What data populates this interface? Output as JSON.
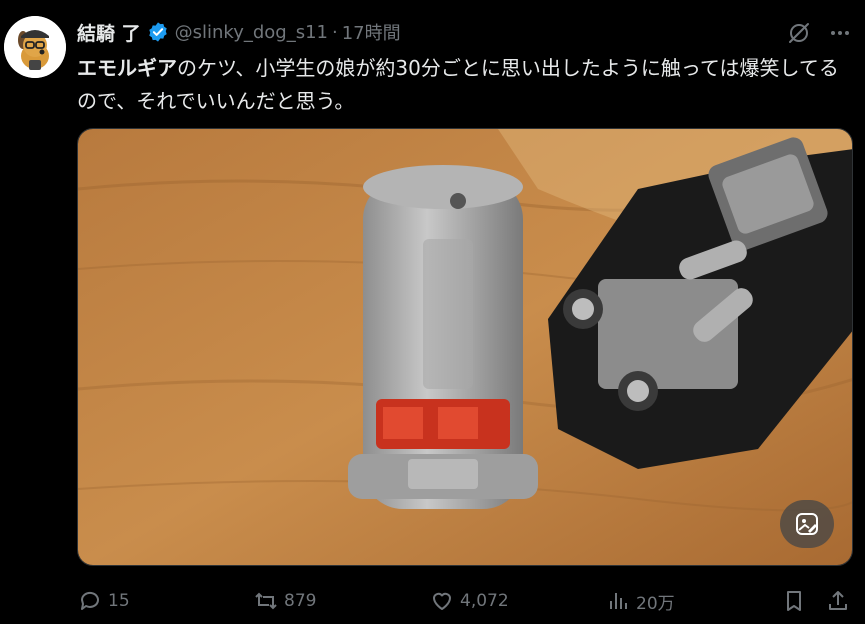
{
  "user": {
    "display_name": "結騎 了",
    "handle": "@slinky_dog_s11",
    "separator": "·",
    "time": "17時間",
    "verified_color": "#1d9bf0"
  },
  "tweet": {
    "text_bold": "エモルギア",
    "text_rest": "のケツ、小学生の娘が約30分ごとに思い出したように触っては爆笑してるので、それでいいんだと思う。"
  },
  "actions": {
    "replies": "15",
    "retweets": "879",
    "likes": "4,072",
    "views": "20万"
  },
  "icons": [
    "grok-icon",
    "more-icon",
    "alt-text-icon",
    "reply-icon",
    "retweet-icon",
    "like-icon",
    "views-icon",
    "bookmark-icon",
    "share-icon"
  ],
  "colors": {
    "background": "#000000",
    "text": "#e7e9ea",
    "muted": "#71767b",
    "accent": "#1d9bf0"
  }
}
